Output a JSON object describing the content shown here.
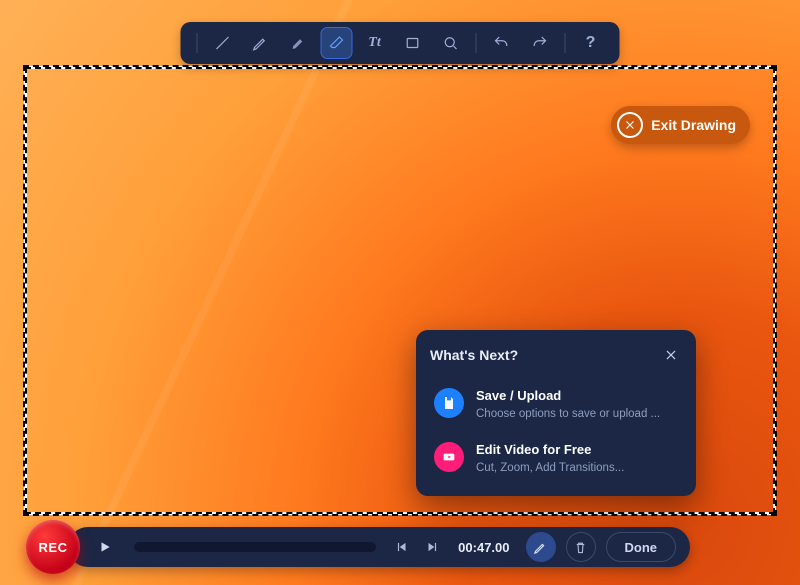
{
  "toolbar": {
    "tools": [
      {
        "name": "line-tool"
      },
      {
        "name": "pen-tool"
      },
      {
        "name": "highlighter-tool"
      },
      {
        "name": "eraser-tool",
        "selected": true
      },
      {
        "name": "text-tool",
        "label": "Tt"
      },
      {
        "name": "rectangle-tool"
      },
      {
        "name": "zoom-tool"
      },
      {
        "name": "undo-tool"
      },
      {
        "name": "redo-tool"
      },
      {
        "name": "help-tool",
        "label": "?"
      }
    ]
  },
  "exit_drawing": {
    "label": "Exit Drawing"
  },
  "popover": {
    "title": "What's Next?",
    "items": [
      {
        "icon": "save-icon",
        "title": "Save / Upload",
        "subtitle": "Choose options to save or upload ..."
      },
      {
        "icon": "edit-video-icon",
        "title": "Edit Video for Free",
        "subtitle": "Cut, Zoom, Add Transitions..."
      }
    ]
  },
  "controls": {
    "rec_label": "REC",
    "time": "00:47.00",
    "done_label": "Done"
  }
}
